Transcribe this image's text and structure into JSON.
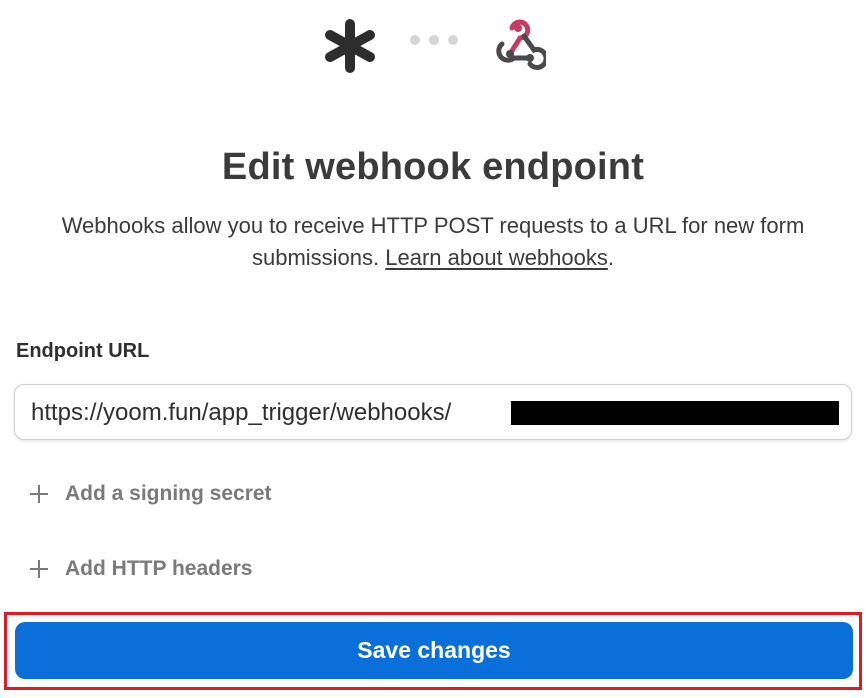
{
  "header": {
    "left_logo": "asterisk-icon",
    "connector": "dots",
    "right_logo": "webhook-icon"
  },
  "title": "Edit webhook endpoint",
  "description": {
    "text": "Webhooks allow you to receive HTTP POST requests to a URL for new form submissions.",
    "link_text": "Learn about webhooks",
    "suffix": "."
  },
  "endpoint": {
    "label": "Endpoint URL",
    "value": "https://yoom.fun/app_trigger/webhooks/"
  },
  "options": {
    "signing_secret_label": "Add a signing secret",
    "http_headers_label": "Add HTTP headers"
  },
  "save_button": {
    "label": "Save changes"
  },
  "colors": {
    "primary": "#0b6fd9",
    "highlight": "#e01b24",
    "webhook_pink": "#c73a63",
    "text": "#3b3b3b",
    "muted": "#7a7a7a"
  }
}
